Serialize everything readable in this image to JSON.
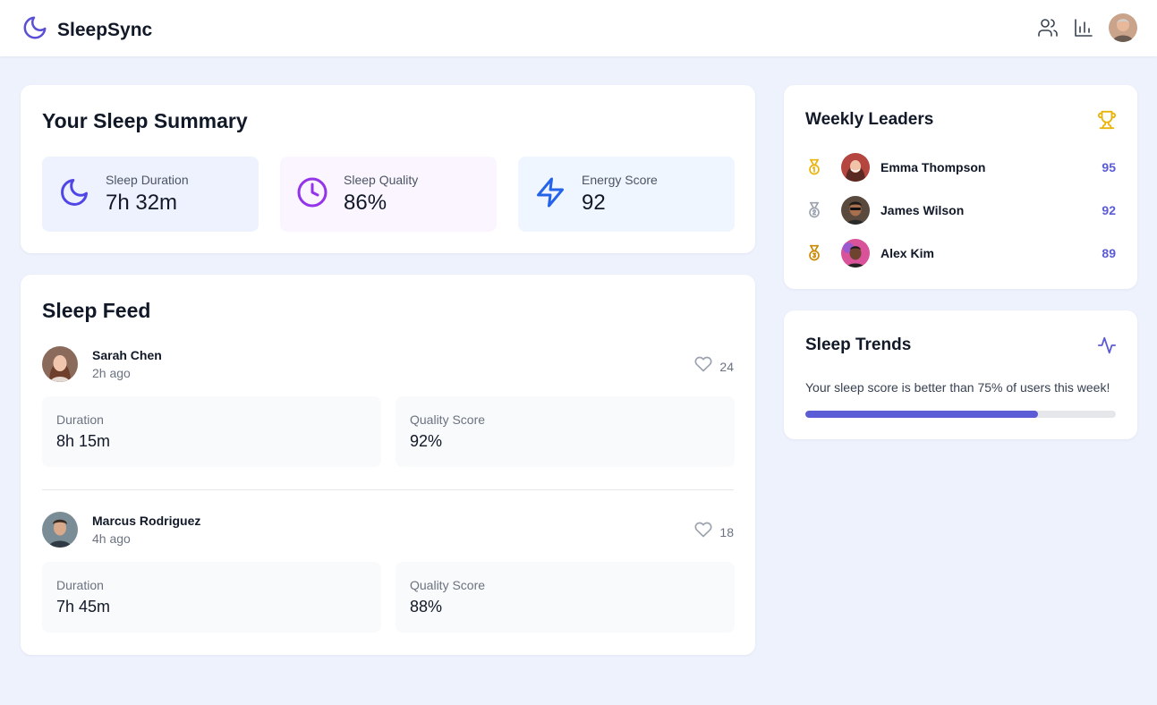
{
  "header": {
    "brand": "SleepSync",
    "icons": [
      "moon-icon",
      "users-icon",
      "bar-chart-icon",
      "user-avatar"
    ]
  },
  "summary": {
    "title": "Your Sleep Summary",
    "stats": [
      {
        "label": "Sleep Duration",
        "value": "7h 32m",
        "icon": "moon-icon",
        "bg": "#eef2ff",
        "color": "#4f46e5"
      },
      {
        "label": "Sleep Quality",
        "value": "86%",
        "icon": "clock-icon",
        "bg": "#faf5ff",
        "color": "#9333ea"
      },
      {
        "label": "Energy Score",
        "value": "92",
        "icon": "lightning-icon",
        "bg": "#eff6ff",
        "color": "#2563eb"
      }
    ]
  },
  "feed": {
    "title": "Sleep Feed",
    "posts": [
      {
        "name": "Sarah Chen",
        "time": "2h ago",
        "likes": "24",
        "duration_label": "Duration",
        "duration": "8h 15m",
        "quality_label": "Quality Score",
        "quality": "92%"
      },
      {
        "name": "Marcus Rodriguez",
        "time": "4h ago",
        "likes": "18",
        "duration_label": "Duration",
        "duration": "7h 45m",
        "quality_label": "Quality Score",
        "quality": "88%"
      }
    ]
  },
  "leaders": {
    "title": "Weekly Leaders",
    "rows": [
      {
        "name": "Emma Thompson",
        "score": "95",
        "medal_color": "#eab308"
      },
      {
        "name": "James Wilson",
        "score": "92",
        "medal_color": "#9ca3af"
      },
      {
        "name": "Alex Kim",
        "score": "89",
        "medal_color": "#ca8a04"
      }
    ]
  },
  "trends": {
    "title": "Sleep Trends",
    "text": "Your sleep score is better than 75% of users this week!",
    "progress": 0.75
  },
  "colors": {
    "accent": "#5b5bd6",
    "background": "#eef2fd"
  }
}
